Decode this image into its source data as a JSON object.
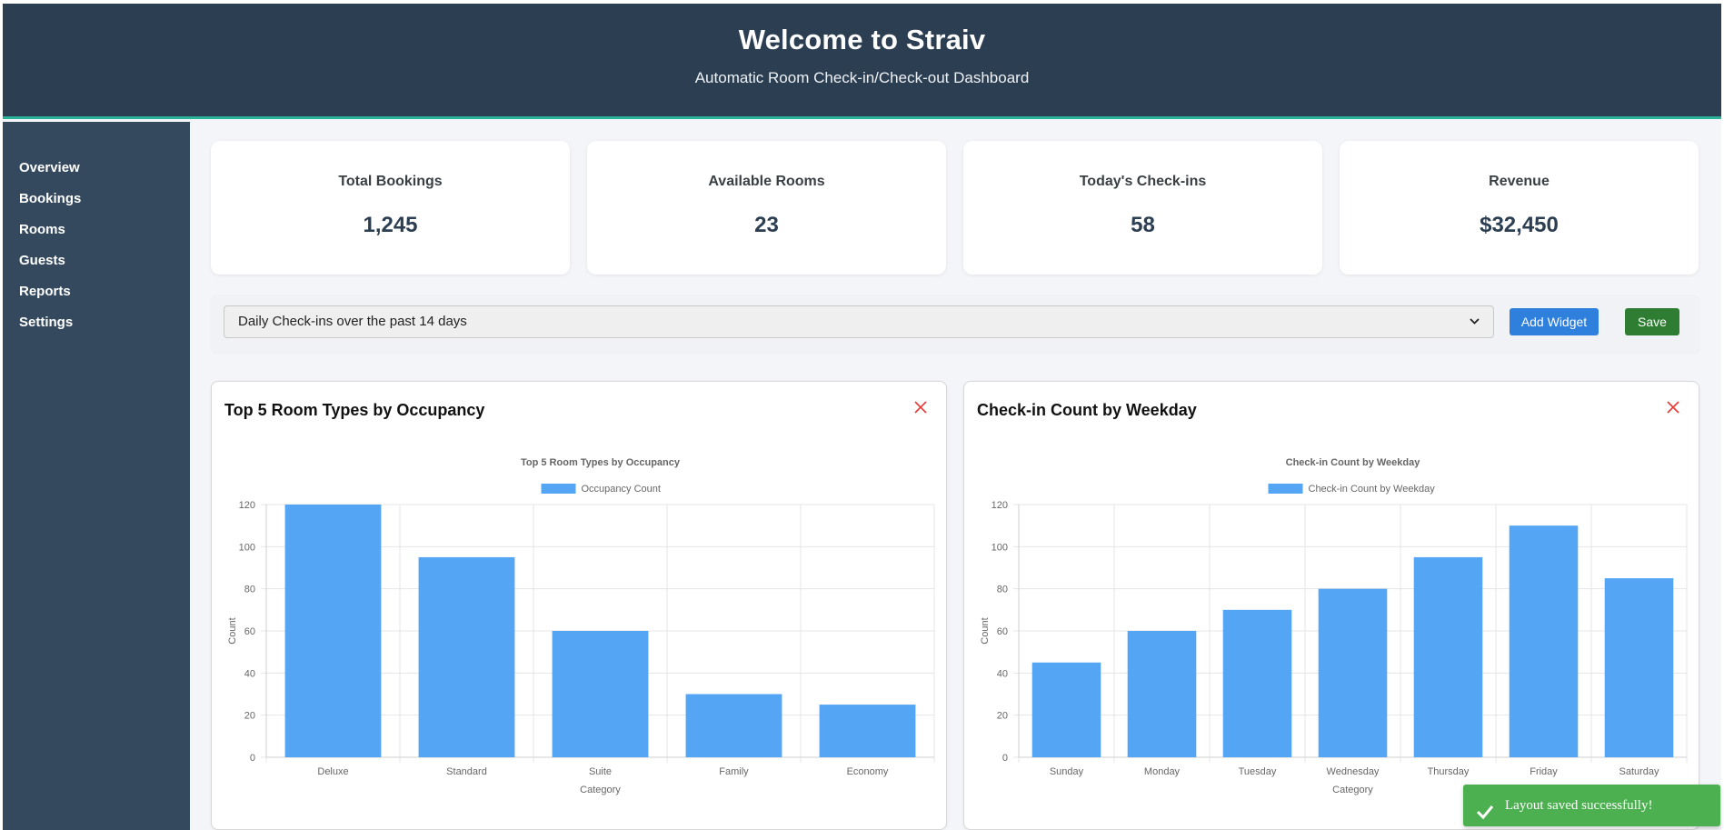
{
  "header": {
    "title": "Welcome to Straiv",
    "subtitle": "Automatic Room Check-in/Check-out Dashboard"
  },
  "sidebar": {
    "items": [
      {
        "label": "Overview"
      },
      {
        "label": "Bookings"
      },
      {
        "label": "Rooms"
      },
      {
        "label": "Guests"
      },
      {
        "label": "Reports"
      },
      {
        "label": "Settings"
      }
    ]
  },
  "stats": [
    {
      "label": "Total Bookings",
      "value": "1,245"
    },
    {
      "label": "Available Rooms",
      "value": "23"
    },
    {
      "label": "Today's Check-ins",
      "value": "58"
    },
    {
      "label": "Revenue",
      "value": "$32,450"
    }
  ],
  "controls": {
    "widget_select_value": "Daily Check-ins over the past 14 days",
    "add_widget_label": "Add Widget",
    "save_label": "Save"
  },
  "widgets": [
    {
      "title": "Top 5 Room Types by Occupancy"
    },
    {
      "title": "Check-in Count by Weekday"
    }
  ],
  "chart_data": [
    {
      "type": "bar",
      "title": "Top 5 Room Types by Occupancy",
      "legend": "Occupancy Count",
      "legend_position": "top",
      "categories": [
        "Deluxe",
        "Standard",
        "Suite",
        "Family",
        "Economy"
      ],
      "values": [
        120,
        95,
        60,
        30,
        25
      ],
      "xlabel": "Category",
      "ylabel": "Count",
      "ylim": [
        0,
        120
      ],
      "yticks": [
        0,
        20,
        40,
        60,
        80,
        100,
        120
      ],
      "grid": true,
      "color": "#55a5f5"
    },
    {
      "type": "bar",
      "title": "Check-in Count by Weekday",
      "legend": "Check-in Count by Weekday",
      "legend_position": "top",
      "categories": [
        "Sunday",
        "Monday",
        "Tuesday",
        "Wednesday",
        "Thursday",
        "Friday",
        "Saturday"
      ],
      "values": [
        45,
        60,
        70,
        80,
        95,
        110,
        85
      ],
      "xlabel": "Category",
      "ylabel": "Count",
      "ylim": [
        0,
        120
      ],
      "yticks": [
        0,
        20,
        40,
        60,
        80,
        100,
        120
      ],
      "grid": true,
      "color": "#55a5f5"
    }
  ],
  "toast": {
    "message": "Layout saved successfully!"
  },
  "colors": {
    "header_bg": "#2c3e51",
    "header_accent": "#2bb39a",
    "sidebar_bg": "#34495e",
    "primary_button": "#2f7fdc",
    "save_button": "#2e7d32",
    "close_icon": "#e53935",
    "toast_bg": "#4caf50"
  }
}
